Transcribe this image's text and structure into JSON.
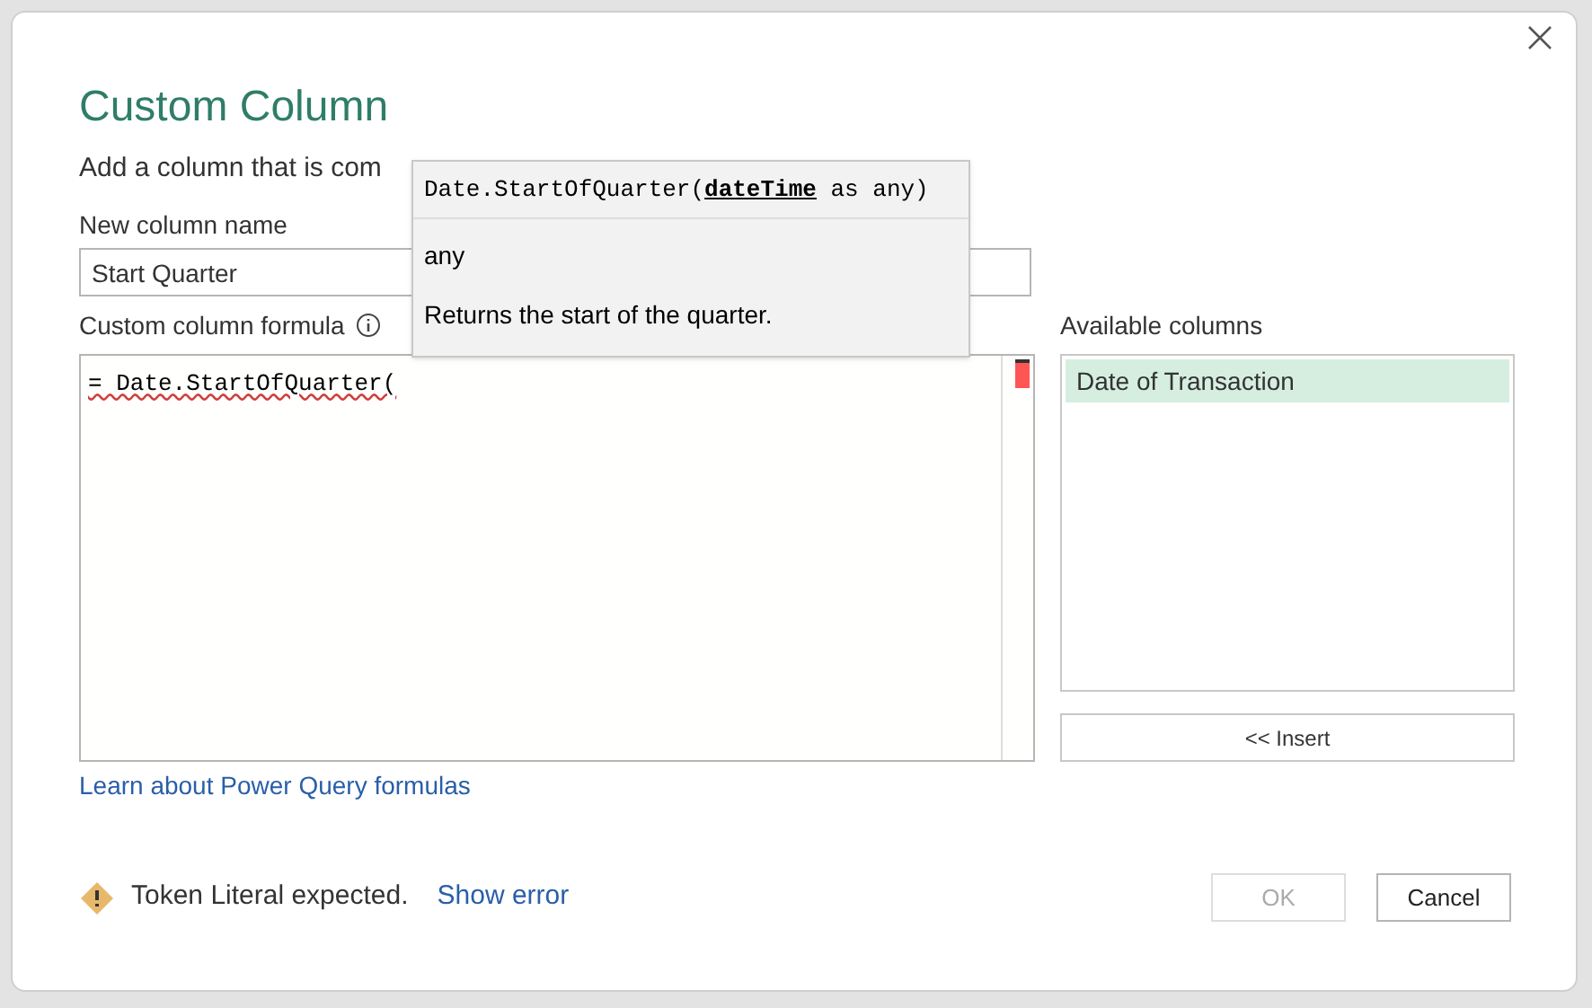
{
  "dialog": {
    "title": "Custom Column",
    "subtitle": "Add a column that is com"
  },
  "name_field": {
    "label": "New column name",
    "value": "Start Quarter"
  },
  "formula": {
    "label": "Custom column formula",
    "value": "= Date.StartOfQuarter("
  },
  "tooltip": {
    "signature_start": "Date.StartOfQuarter(",
    "parameter": "dateTime",
    "signature_end": " as any)",
    "return_type": "any",
    "description": "Returns the start of the quarter."
  },
  "available_columns": {
    "label": "Available columns",
    "items": [
      {
        "label": "Date of Transaction",
        "selected": true
      }
    ],
    "insert_button": "<< Insert"
  },
  "help_link": "Learn about Power Query formulas",
  "status": {
    "message": "Token Literal expected.",
    "link": "Show error"
  },
  "buttons": [
    {
      "label": "OK",
      "disabled": true
    },
    {
      "label": "Cancel",
      "disabled": false
    }
  ]
}
